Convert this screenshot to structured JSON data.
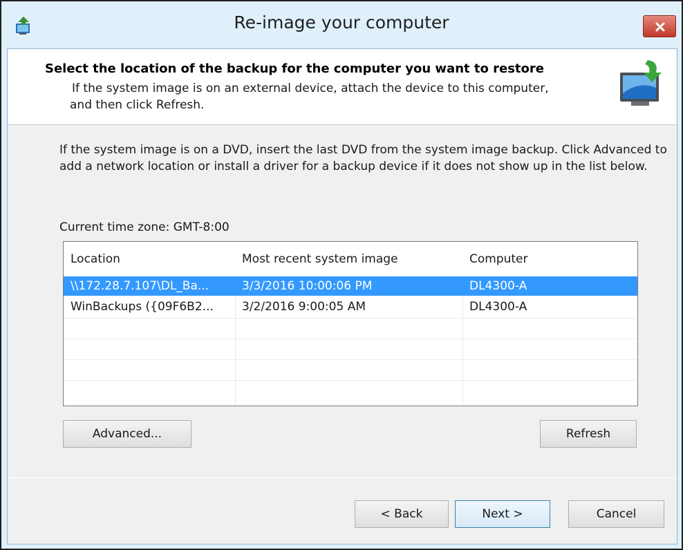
{
  "window": {
    "title": "Re-image your computer"
  },
  "header": {
    "title": "Select the location of the backup for the computer you want to restore",
    "desc_line1": "If the system image is on an external device, attach the device to this computer,",
    "desc_line2": "and then click Refresh."
  },
  "body": {
    "instructions": "If the system image is on a DVD, insert the last DVD from the system image backup. Click Advanced to add a network location or install a driver for a backup device if it does not show up in the list below.",
    "timezone": "Current time zone: GMT-8:00"
  },
  "list": {
    "columns": [
      "Location",
      "Most recent system image",
      "Computer"
    ],
    "rows": [
      {
        "location": "\\\\172.28.7.107\\DL_Ba...",
        "image": "3/3/2016 10:00:06 PM",
        "computer": "DL4300-A",
        "selected": true
      },
      {
        "location": "WinBackups ({09F6B2...",
        "image": "3/2/2016 9:00:05 AM",
        "computer": "DL4300-A",
        "selected": false
      }
    ]
  },
  "buttons": {
    "advanced": "Advanced...",
    "refresh": "Refresh",
    "back": "< Back",
    "next": "Next >",
    "cancel": "Cancel"
  },
  "colors": {
    "selection": "#3399ff",
    "close_button": "#c2382a",
    "title_bar": "#dff0fb"
  },
  "icons": {
    "app": "reimage-app-icon",
    "header": "backup-restore-icon",
    "close": "close-icon"
  }
}
